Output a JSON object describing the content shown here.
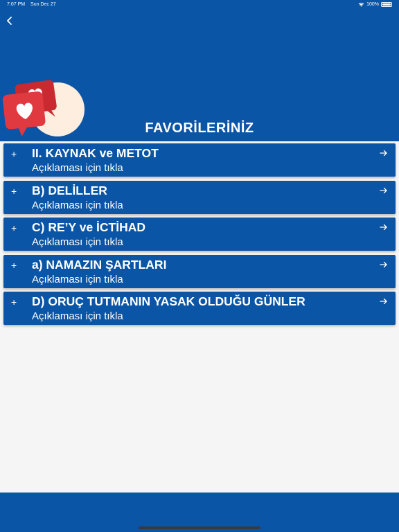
{
  "status": {
    "time": "7:07 PM",
    "date": "Sun Dec 27",
    "battery": "100%"
  },
  "header": {
    "title": "FAVORİLERİNİZ"
  },
  "items": [
    {
      "title": "II. KAYNAK ve METOT",
      "subtitle": "Açıklaması için tıkla"
    },
    {
      "title": "B) DELİLLER",
      "subtitle": "Açıklaması için tıkla"
    },
    {
      "title": "C) RE’Y ve İCTİHAD",
      "subtitle": "Açıklaması için tıkla"
    },
    {
      "title": "a) NAMAZIN ŞARTLARI",
      "subtitle": "Açıklaması için tıkla"
    },
    {
      "title": "D) ORUÇ TUTMANIN YASAK OLDUĞU GÜNLER",
      "subtitle": "Açıklaması için tıkla"
    }
  ],
  "icons": {
    "back": "chevron-left-icon",
    "expand": "plus-icon",
    "open": "arrow-right-icon",
    "hero": "heart-chat-bubbles-icon"
  },
  "colors": {
    "primary": "#0a55a6",
    "background": "#f5f5f5",
    "heart_bubble": "#e0393f"
  }
}
